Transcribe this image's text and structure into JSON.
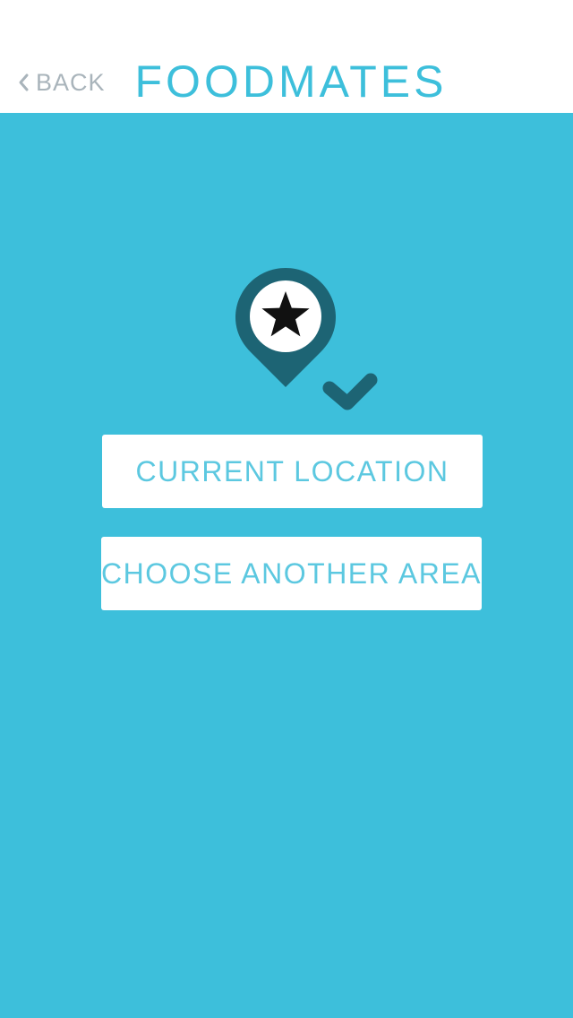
{
  "header": {
    "back_label": "BACK",
    "title": "FOODMATES"
  },
  "main": {
    "icon": "location-pin-star-check-icon",
    "buttons": {
      "current_location": "CURRENT LOCATION",
      "choose_another_area": "CHOOSE ANOTHER AREA"
    }
  },
  "colors": {
    "background": "#3dbfdb",
    "header_background": "#ffffff",
    "accent": "#3dbfdb",
    "button_text": "#5cc8e0",
    "back_text": "#a9b4bb",
    "pin": "#1d6474"
  }
}
